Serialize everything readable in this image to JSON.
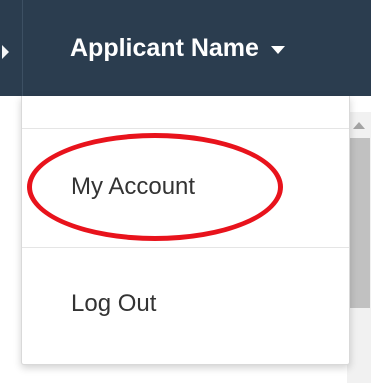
{
  "navbar": {
    "account_name": "Applicant Name"
  },
  "dropdown": {
    "items": [
      {
        "label": "My Account"
      },
      {
        "label": "Log Out"
      }
    ]
  },
  "colors": {
    "navbar_bg": "#2b3d4f",
    "highlight_ring": "#e8131c",
    "menu_text": "#333333"
  },
  "icons": {
    "left_caret": "caret-left-icon",
    "dropdown_caret": "caret-down-icon",
    "scroll_up": "scroll-up-arrow-icon"
  }
}
